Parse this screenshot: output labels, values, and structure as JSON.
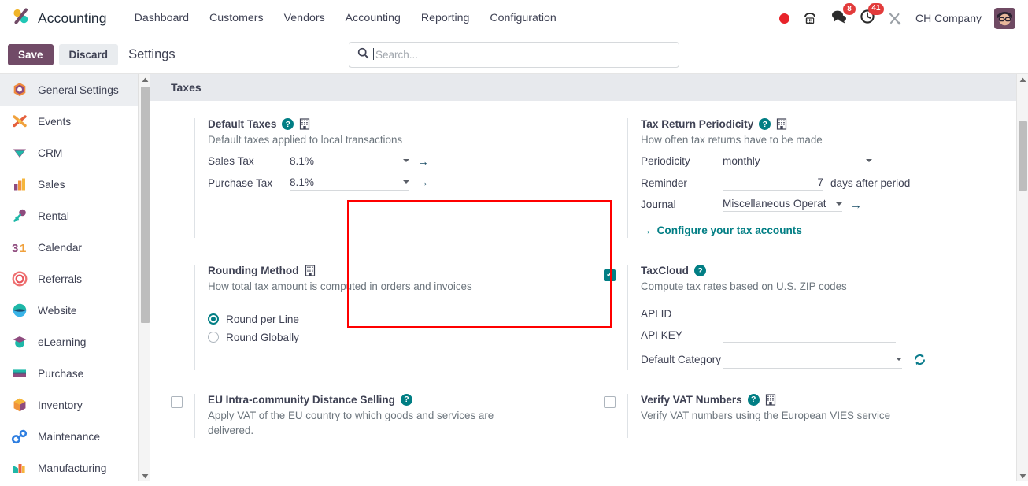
{
  "app": {
    "brand": "Accounting",
    "logo_icon": "odoo-accounting-logo-icon"
  },
  "navbar": {
    "menu": [
      {
        "label": "Dashboard"
      },
      {
        "label": "Customers"
      },
      {
        "label": "Vendors"
      },
      {
        "label": "Accounting"
      },
      {
        "label": "Reporting"
      },
      {
        "label": "Configuration"
      }
    ],
    "systray": {
      "record_icon": "record-dot-icon",
      "phone_icon": "phone-icon",
      "messages_icon": "chat-bubble-icon",
      "messages_count": "8",
      "activities_icon": "clock-icon",
      "activities_count": "41",
      "tools_icon": "tools-icon",
      "company": "CH Company",
      "avatar": "user-avatar"
    }
  },
  "control_panel": {
    "save_label": "Save",
    "discard_label": "Discard",
    "title": "Settings"
  },
  "search": {
    "placeholder": "Search...",
    "icon": "search-icon",
    "value": ""
  },
  "sidebar": {
    "items": [
      {
        "label": "General Settings",
        "icon": "settings-gear-icon"
      },
      {
        "label": "Events",
        "icon": "events-icon"
      },
      {
        "label": "CRM",
        "icon": "crm-icon"
      },
      {
        "label": "Sales",
        "icon": "sales-chart-icon"
      },
      {
        "label": "Rental",
        "icon": "rental-key-icon"
      },
      {
        "label": "Calendar",
        "icon": "calendar-31-icon"
      },
      {
        "label": "Referrals",
        "icon": "referrals-target-icon"
      },
      {
        "label": "Website",
        "icon": "website-globe-icon"
      },
      {
        "label": "eLearning",
        "icon": "elearning-cap-icon"
      },
      {
        "label": "Purchase",
        "icon": "purchase-icon"
      },
      {
        "label": "Inventory",
        "icon": "inventory-box-icon"
      },
      {
        "label": "Maintenance",
        "icon": "maintenance-wrench-icon"
      },
      {
        "label": "Manufacturing",
        "icon": "manufacturing-icon"
      }
    ]
  },
  "main": {
    "section_title": "Taxes",
    "settings": {
      "default_taxes": {
        "title": "Default Taxes",
        "help_icon": "question-mark-icon",
        "company_icon": "building-icon",
        "description": "Default taxes applied to local transactions",
        "fields": [
          {
            "label": "Sales Tax",
            "value": "8.1%",
            "caret": "chevron-down-icon",
            "link": "internal-link-arrow-icon"
          },
          {
            "label": "Purchase Tax",
            "value": "8.1%",
            "caret": "chevron-down-icon",
            "link": "internal-link-arrow-icon"
          }
        ]
      },
      "tax_return_periodicity": {
        "title": "Tax Return Periodicity",
        "help_icon": "question-mark-icon",
        "company_icon": "building-icon",
        "description": "How often tax returns have to be made",
        "periodicity_label": "Periodicity",
        "periodicity_value": "monthly",
        "reminder_label": "Reminder",
        "reminder_value": "7",
        "reminder_suffix": "days after period",
        "journal_label": "Journal",
        "journal_value": "Miscellaneous Operat",
        "configure_link": "Configure your tax accounts",
        "configure_link_icon": "arrow-right-icon"
      },
      "rounding_method": {
        "title": "Rounding Method",
        "company_icon": "building-icon",
        "description": "How total tax amount is computed in orders and invoices",
        "options": [
          {
            "label": "Round per Line",
            "selected": true
          },
          {
            "label": "Round Globally",
            "selected": false
          }
        ]
      },
      "taxcloud": {
        "title": "TaxCloud",
        "help_icon": "question-mark-icon",
        "checked": true,
        "description": "Compute tax rates based on U.S. ZIP codes",
        "api_id_label": "API ID",
        "api_id_value": "",
        "api_key_label": "API KEY",
        "api_key_value": "",
        "default_category_label": "Default Category",
        "default_category_value": "",
        "refresh_icon": "refresh-icon"
      },
      "eu_distance_selling": {
        "title": "EU Intra-community Distance Selling",
        "help_icon": "question-mark-icon",
        "checked": false,
        "description": "Apply VAT of the EU country to which goods and services are delivered."
      },
      "verify_vat": {
        "title": "Verify VAT Numbers",
        "help_icon": "question-mark-icon",
        "company_icon": "building-icon",
        "checked": false,
        "description": "Verify VAT numbers using the European VIES service"
      }
    }
  },
  "colors": {
    "odoo_purple": "#714b67",
    "teal_accent": "#017e84",
    "highlight_red": "#ff0000",
    "badge_red": "#e23b3b"
  }
}
